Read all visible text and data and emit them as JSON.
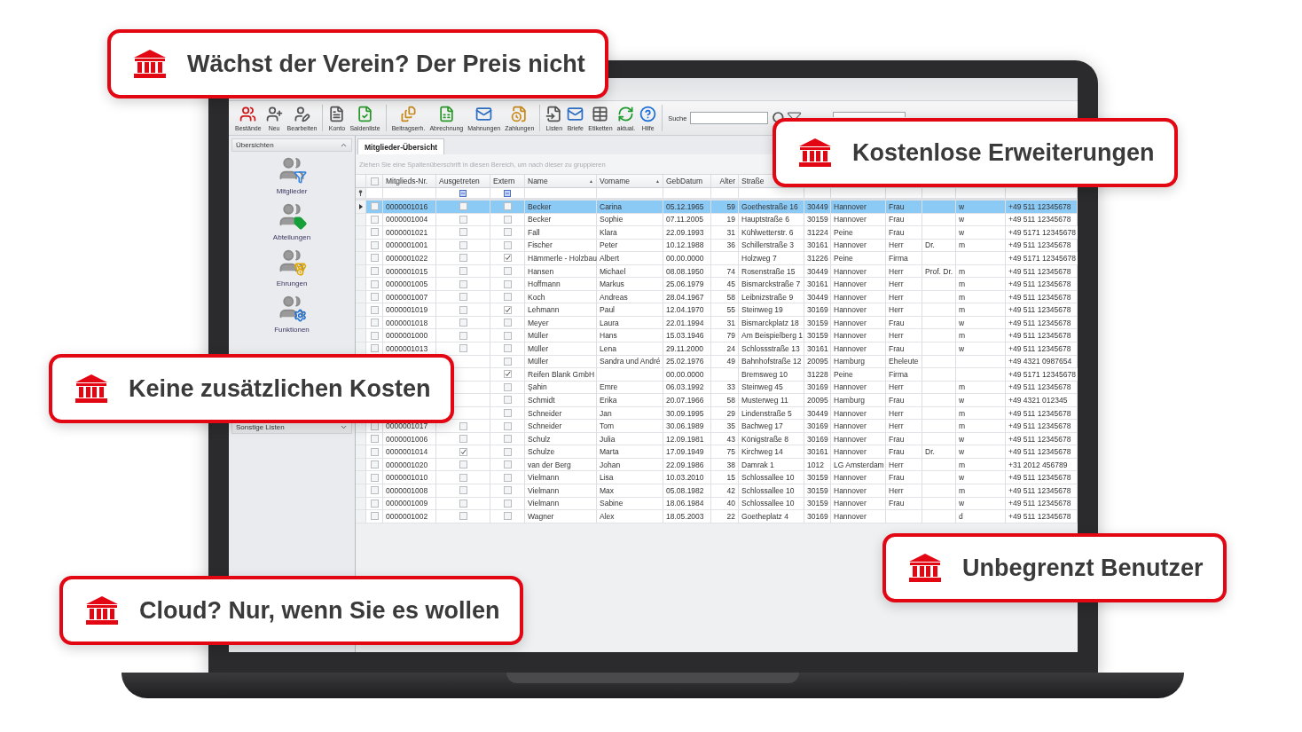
{
  "toolbar": {
    "groups": [
      [
        "Bestände",
        "Neu",
        "Bearbeiten"
      ],
      [
        "Konto",
        "Saldenliste"
      ],
      [
        "Beitragserh.",
        "Abrechnung",
        "Mahnungen",
        "Zahlungen"
      ],
      [
        "Listen",
        "Briefe",
        "Etiketten",
        "aktual.",
        "Hilfe"
      ]
    ],
    "search": {
      "label": "Suche"
    }
  },
  "sidebar": {
    "sections": [
      {
        "title": "Übersichten",
        "expanded": true,
        "items": [
          "Mitglieder",
          "Abteilungen",
          "Ehrungen",
          "Funktionen"
        ]
      },
      {
        "title": "Sonstige Listen",
        "expanded": false
      }
    ]
  },
  "tabs": [
    {
      "label": "Mitglieder-Übersicht",
      "selected": true
    }
  ],
  "group_panel": {
    "placeholder": "Ziehen Sie eine Spaltenüberschrift in diesen Bereich, um nach dieser zu gruppieren"
  },
  "table": {
    "header_checkbox": {
      "checked": false
    },
    "columns": [
      {
        "label": "Mitglieds-Nr.",
        "kind": "text"
      },
      {
        "label": "Ausgetreten",
        "kind": "check"
      },
      {
        "label": "Extern",
        "kind": "check"
      },
      {
        "label": "Name",
        "kind": "text",
        "sort_icon": "▲"
      },
      {
        "label": "Vorname",
        "kind": "text",
        "sort_icon": "▲"
      },
      {
        "label": "GebDatum",
        "kind": "text"
      },
      {
        "label": "Alter",
        "kind": "number"
      },
      {
        "label": "Straße",
        "kind": "text"
      }
    ],
    "rows": [
      {
        "selected": true,
        "checked": false,
        "cells": [
          "0000001016",
          {
            "checked": false
          },
          {
            "checked": false
          },
          "Becker",
          "Carina",
          "05.12.1965",
          "59",
          "Goethestraße 16",
          "30449",
          "Hannover",
          "Frau",
          "",
          "w",
          "+49 511 12345678"
        ]
      },
      {
        "selected": false,
        "checked": false,
        "cells": [
          "0000001004",
          {
            "checked": false
          },
          {
            "checked": false
          },
          "Becker",
          "Sophie",
          "07.11.2005",
          "19",
          "Hauptstraße 6",
          "30159",
          "Hannover",
          "Frau",
          "",
          "w",
          "+49 511 12345678"
        ]
      },
      {
        "selected": false,
        "checked": false,
        "cells": [
          "0000001021",
          {
            "checked": false
          },
          {
            "checked": false
          },
          "Fall",
          "Klara",
          "22.09.1993",
          "31",
          "Kühlwetterstr. 6",
          "31224",
          "Peine",
          "Frau",
          "",
          "w",
          "+49 5171 12345678"
        ]
      },
      {
        "selected": false,
        "checked": false,
        "cells": [
          "0000001001",
          {
            "checked": false
          },
          {
            "checked": false
          },
          "Fischer",
          "Peter",
          "10.12.1988",
          "36",
          "Schillerstraße 3",
          "30161",
          "Hannover",
          "Herr",
          "Dr.",
          "m",
          "+49 511 12345678"
        ]
      },
      {
        "selected": false,
        "checked": false,
        "cells": [
          "0000001022",
          {
            "checked": false
          },
          {
            "checked": true
          },
          "Hämmerle - Holzbau",
          "Albert",
          "00.00.0000",
          "",
          "Holzweg 7",
          "31226",
          "Peine",
          "Firma",
          "",
          "",
          "+49 5171 12345678"
        ]
      },
      {
        "selected": false,
        "checked": false,
        "cells": [
          "0000001015",
          {
            "checked": false
          },
          {
            "checked": false
          },
          "Hansen",
          "Michael",
          "08.08.1950",
          "74",
          "Rosenstraße 15",
          "30449",
          "Hannover",
          "Herr",
          "Prof. Dr.",
          "m",
          "+49 511 12345678"
        ]
      },
      {
        "selected": false,
        "checked": false,
        "cells": [
          "0000001005",
          {
            "checked": false
          },
          {
            "checked": false
          },
          "Hoffmann",
          "Markus",
          "25.06.1979",
          "45",
          "Bismarckstraße 7",
          "30161",
          "Hannover",
          "Herr",
          "",
          "m",
          "+49 511 12345678"
        ]
      },
      {
        "selected": false,
        "checked": false,
        "cells": [
          "0000001007",
          {
            "checked": false
          },
          {
            "checked": false
          },
          "Koch",
          "Andreas",
          "28.04.1967",
          "58",
          "Leibnizstraße 9",
          "30449",
          "Hannover",
          "Herr",
          "",
          "m",
          "+49 511 12345678"
        ]
      },
      {
        "selected": false,
        "checked": false,
        "cells": [
          "0000001019",
          {
            "checked": false
          },
          {
            "checked": true
          },
          "Lehmann",
          "Paul",
          "12.04.1970",
          "55",
          "Steinweg 19",
          "30169",
          "Hannover",
          "Herr",
          "",
          "m",
          "+49 511 12345678"
        ]
      },
      {
        "selected": false,
        "checked": false,
        "cells": [
          "0000001018",
          {
            "checked": false
          },
          {
            "checked": false
          },
          "Meyer",
          "Laura",
          "22.01.1994",
          "31",
          "Bismarckplatz 18",
          "30159",
          "Hannover",
          "Frau",
          "",
          "w",
          "+49 511 12345678"
        ]
      },
      {
        "selected": false,
        "checked": false,
        "cells": [
          "0000001000",
          {
            "checked": false
          },
          {
            "checked": false
          },
          "Müller",
          "Hans",
          "15.03.1946",
          "79",
          "Am Beispielberg 1",
          "30159",
          "Hannover",
          "Herr",
          "",
          "m",
          "+49 511 12345678"
        ]
      },
      {
        "selected": false,
        "checked": false,
        "cells": [
          "0000001013",
          {
            "checked": false
          },
          {
            "checked": false
          },
          "Müller",
          "Lena",
          "29.11.2000",
          "24",
          "Schlossstraße 13",
          "30161",
          "Hannover",
          "Frau",
          "",
          "w",
          "+49 511 12345678"
        ]
      },
      {
        "selected": false,
        "cells": [
          "",
          "",
          {
            "checked": false
          },
          "Müller",
          "Sandra und André",
          "25.02.1976",
          "49",
          "Bahnhofstraße 12",
          "20095",
          "Hamburg",
          "Eheleute",
          "",
          "",
          "+49 4321 0987654"
        ]
      },
      {
        "selected": false,
        "cells": [
          "",
          "",
          {
            "checked": true
          },
          "Reifen Blank GmbH",
          "",
          "00.00.0000",
          "",
          "Bremsweg 10",
          "31228",
          "Peine",
          "Firma",
          "",
          "",
          "+49 5171 12345678"
        ]
      },
      {
        "selected": false,
        "cells": [
          "",
          "",
          {
            "checked": false
          },
          "Şahin",
          "Emre",
          "06.03.1992",
          "33",
          "Steinweg 45",
          "30169",
          "Hannover",
          "Herr",
          "",
          "m",
          "+49 511 12345678"
        ]
      },
      {
        "selected": false,
        "cells": [
          "",
          "",
          {
            "checked": false
          },
          "Schmidt",
          "Erika",
          "20.07.1966",
          "58",
          "Musterweg 11",
          "20095",
          "Hamburg",
          "Frau",
          "",
          "w",
          "+49 4321 012345"
        ]
      },
      {
        "selected": false,
        "cells": [
          "",
          "",
          {
            "checked": false
          },
          "Schneider",
          "Jan",
          "30.09.1995",
          "29",
          "Lindenstraße 5",
          "30449",
          "Hannover",
          "Herr",
          "",
          "m",
          "+49 511 12345678"
        ]
      },
      {
        "selected": false,
        "checked": false,
        "cells": [
          "0000001017",
          {
            "checked": false
          },
          {
            "checked": false
          },
          "Schneider",
          "Tom",
          "30.06.1989",
          "35",
          "Bachweg 17",
          "30169",
          "Hannover",
          "Herr",
          "",
          "m",
          "+49 511 12345678"
        ]
      },
      {
        "selected": false,
        "checked": false,
        "cells": [
          "0000001006",
          {
            "checked": false
          },
          {
            "checked": false
          },
          "Schulz",
          "Julia",
          "12.09.1981",
          "43",
          "Königstraße 8",
          "30169",
          "Hannover",
          "Frau",
          "",
          "w",
          "+49 511 12345678"
        ]
      },
      {
        "selected": false,
        "checked": false,
        "cells": [
          "0000001014",
          {
            "checked": true
          },
          {
            "checked": false
          },
          "Schulze",
          "Marta",
          "17.09.1949",
          "75",
          "Kirchweg 14",
          "30161",
          "Hannover",
          "Frau",
          "Dr.",
          "w",
          "+49 511 12345678"
        ]
      },
      {
        "selected": false,
        "checked": false,
        "cells": [
          "0000001020",
          {
            "checked": false
          },
          {
            "checked": false
          },
          "van der Berg",
          "Johan",
          "22.09.1986",
          "38",
          "Damrak 1",
          "1012",
          "LG Amsterdam",
          "Herr",
          "",
          "m",
          "+31 2012 456789"
        ]
      },
      {
        "selected": false,
        "checked": false,
        "cells": [
          "0000001010",
          {
            "checked": false
          },
          {
            "checked": false
          },
          "Vielmann",
          "Lisa",
          "10.03.2010",
          "15",
          "Schlossallee 10",
          "30159",
          "Hannover",
          "Frau",
          "",
          "w",
          "+49 511 12345678"
        ]
      },
      {
        "selected": false,
        "checked": false,
        "cells": [
          "0000001008",
          {
            "checked": false
          },
          {
            "checked": false
          },
          "Vielmann",
          "Max",
          "05.08.1982",
          "42",
          "Schlossallee 10",
          "30159",
          "Hannover",
          "Herr",
          "",
          "m",
          "+49 511 12345678"
        ]
      },
      {
        "selected": false,
        "checked": false,
        "cells": [
          "0000001009",
          {
            "checked": false
          },
          {
            "checked": false
          },
          "Vielmann",
          "Sabine",
          "18.06.1984",
          "40",
          "Schlossallee 10",
          "30159",
          "Hannover",
          "Frau",
          "",
          "w",
          "+49 511 12345678"
        ]
      },
      {
        "selected": false,
        "checked": false,
        "cells": [
          "0000001002",
          {
            "checked": false
          },
          {
            "checked": false
          },
          "Wagner",
          "Alex",
          "18.05.2003",
          "22",
          "Goetheplatz 4",
          "30169",
          "Hannover",
          "",
          "",
          "d",
          "+49 511 12345678"
        ]
      }
    ]
  },
  "callouts": [
    "Wächst der Verein? Der Preis nicht",
    "Kostenlose Erweiterungen",
    "Keine zusätzlichen Kosten",
    "Unbegrenzt Benutzer",
    "Cloud? Nur, wenn Sie es wollen"
  ]
}
